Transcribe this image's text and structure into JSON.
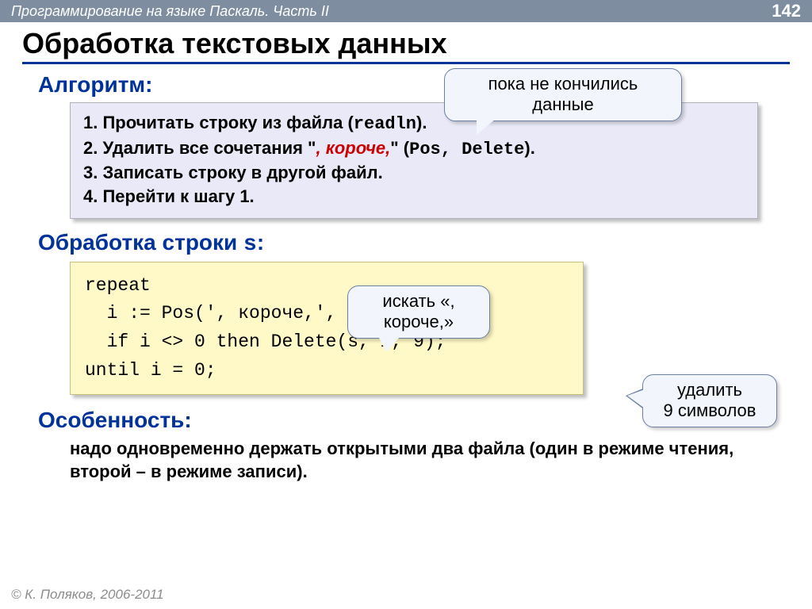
{
  "header": {
    "crumb": "Программирование на языке Паскаль. Часть II",
    "page": "142"
  },
  "title": "Обработка текстовых данных",
  "sections": {
    "algo_heading": "Алгоритм:",
    "processing_heading_prefix": "Обработка строки ",
    "processing_heading_var": "s",
    "processing_heading_suffix": ":",
    "feature_heading": "Особенность:"
  },
  "algo": {
    "l1a": "1. Прочитать строку из файла (",
    "l1b": "readln",
    "l1c": ").",
    "l2a": "2. Удалить все сочетания \"",
    "l2b": ", короче,",
    "l2c": "\" (",
    "l2d": "Pos",
    "l2e": ", ",
    "l2f": "Delete",
    "l2g": ").",
    "l3": "3. Записать строку в другой файл.",
    "l4": "4. Перейти к шагу 1."
  },
  "code": "repeat\n  i := Pos(', короче,', s);\n  if i <> 0 then Delete(s, i, 9);\nuntil i = 0;",
  "feature_text": "надо одновременно держать открытыми два файла (один в режиме чтения, второй – в режиме записи).",
  "callouts": {
    "c1": "пока не кончились данные",
    "c2": "искать «, короче,»",
    "c3": "удалить 9 символов"
  },
  "footer": {
    "copy": "© ",
    "author": "К. Поляков, 2006-2011"
  }
}
